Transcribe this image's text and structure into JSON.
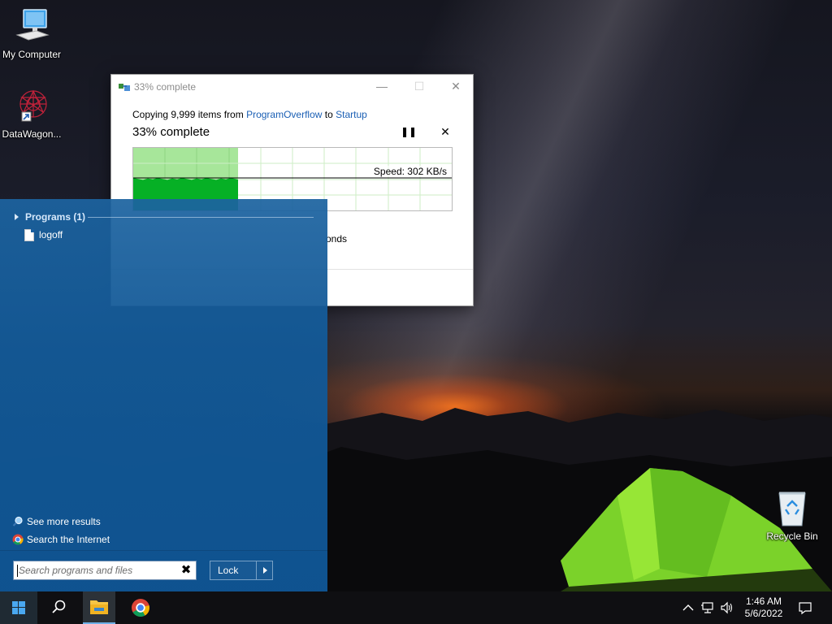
{
  "desktop": {
    "icons": [
      {
        "label": "My Computer"
      },
      {
        "label": "DataWagon..."
      },
      {
        "label": "Recycle Bin"
      }
    ]
  },
  "copy_dialog": {
    "title": "33% complete",
    "copy_prefix": "Copying 9,999 items from ",
    "source": "ProgramOverflow",
    "to_word": " to ",
    "destination": "Startup",
    "percent_label": "33% complete",
    "progress_fraction": 0.33,
    "speed": "Speed: 302 KB/s",
    "time_remaining_partial": "onds",
    "pause_glyph": "❚❚",
    "cancel_glyph": "✕",
    "minimize_glyph": "—",
    "maximize_glyph": "☐",
    "close_glyph": "✕"
  },
  "start_menu": {
    "results_header": "Programs (1)",
    "programs": [
      {
        "label": "logoff"
      }
    ],
    "see_more": "See more results",
    "search_internet": "Search the Internet",
    "search_placeholder": "Search programs and files",
    "clear_glyph": "✖",
    "power_button_label": "Lock"
  },
  "taskbar": {
    "time": "1:46 AM",
    "date": "5/6/2022"
  },
  "colors": {
    "accent": "#1a5fb4",
    "start_menu_bg": "#12589a",
    "progress_green": "#06b025",
    "progress_light": "#a7e69a"
  }
}
